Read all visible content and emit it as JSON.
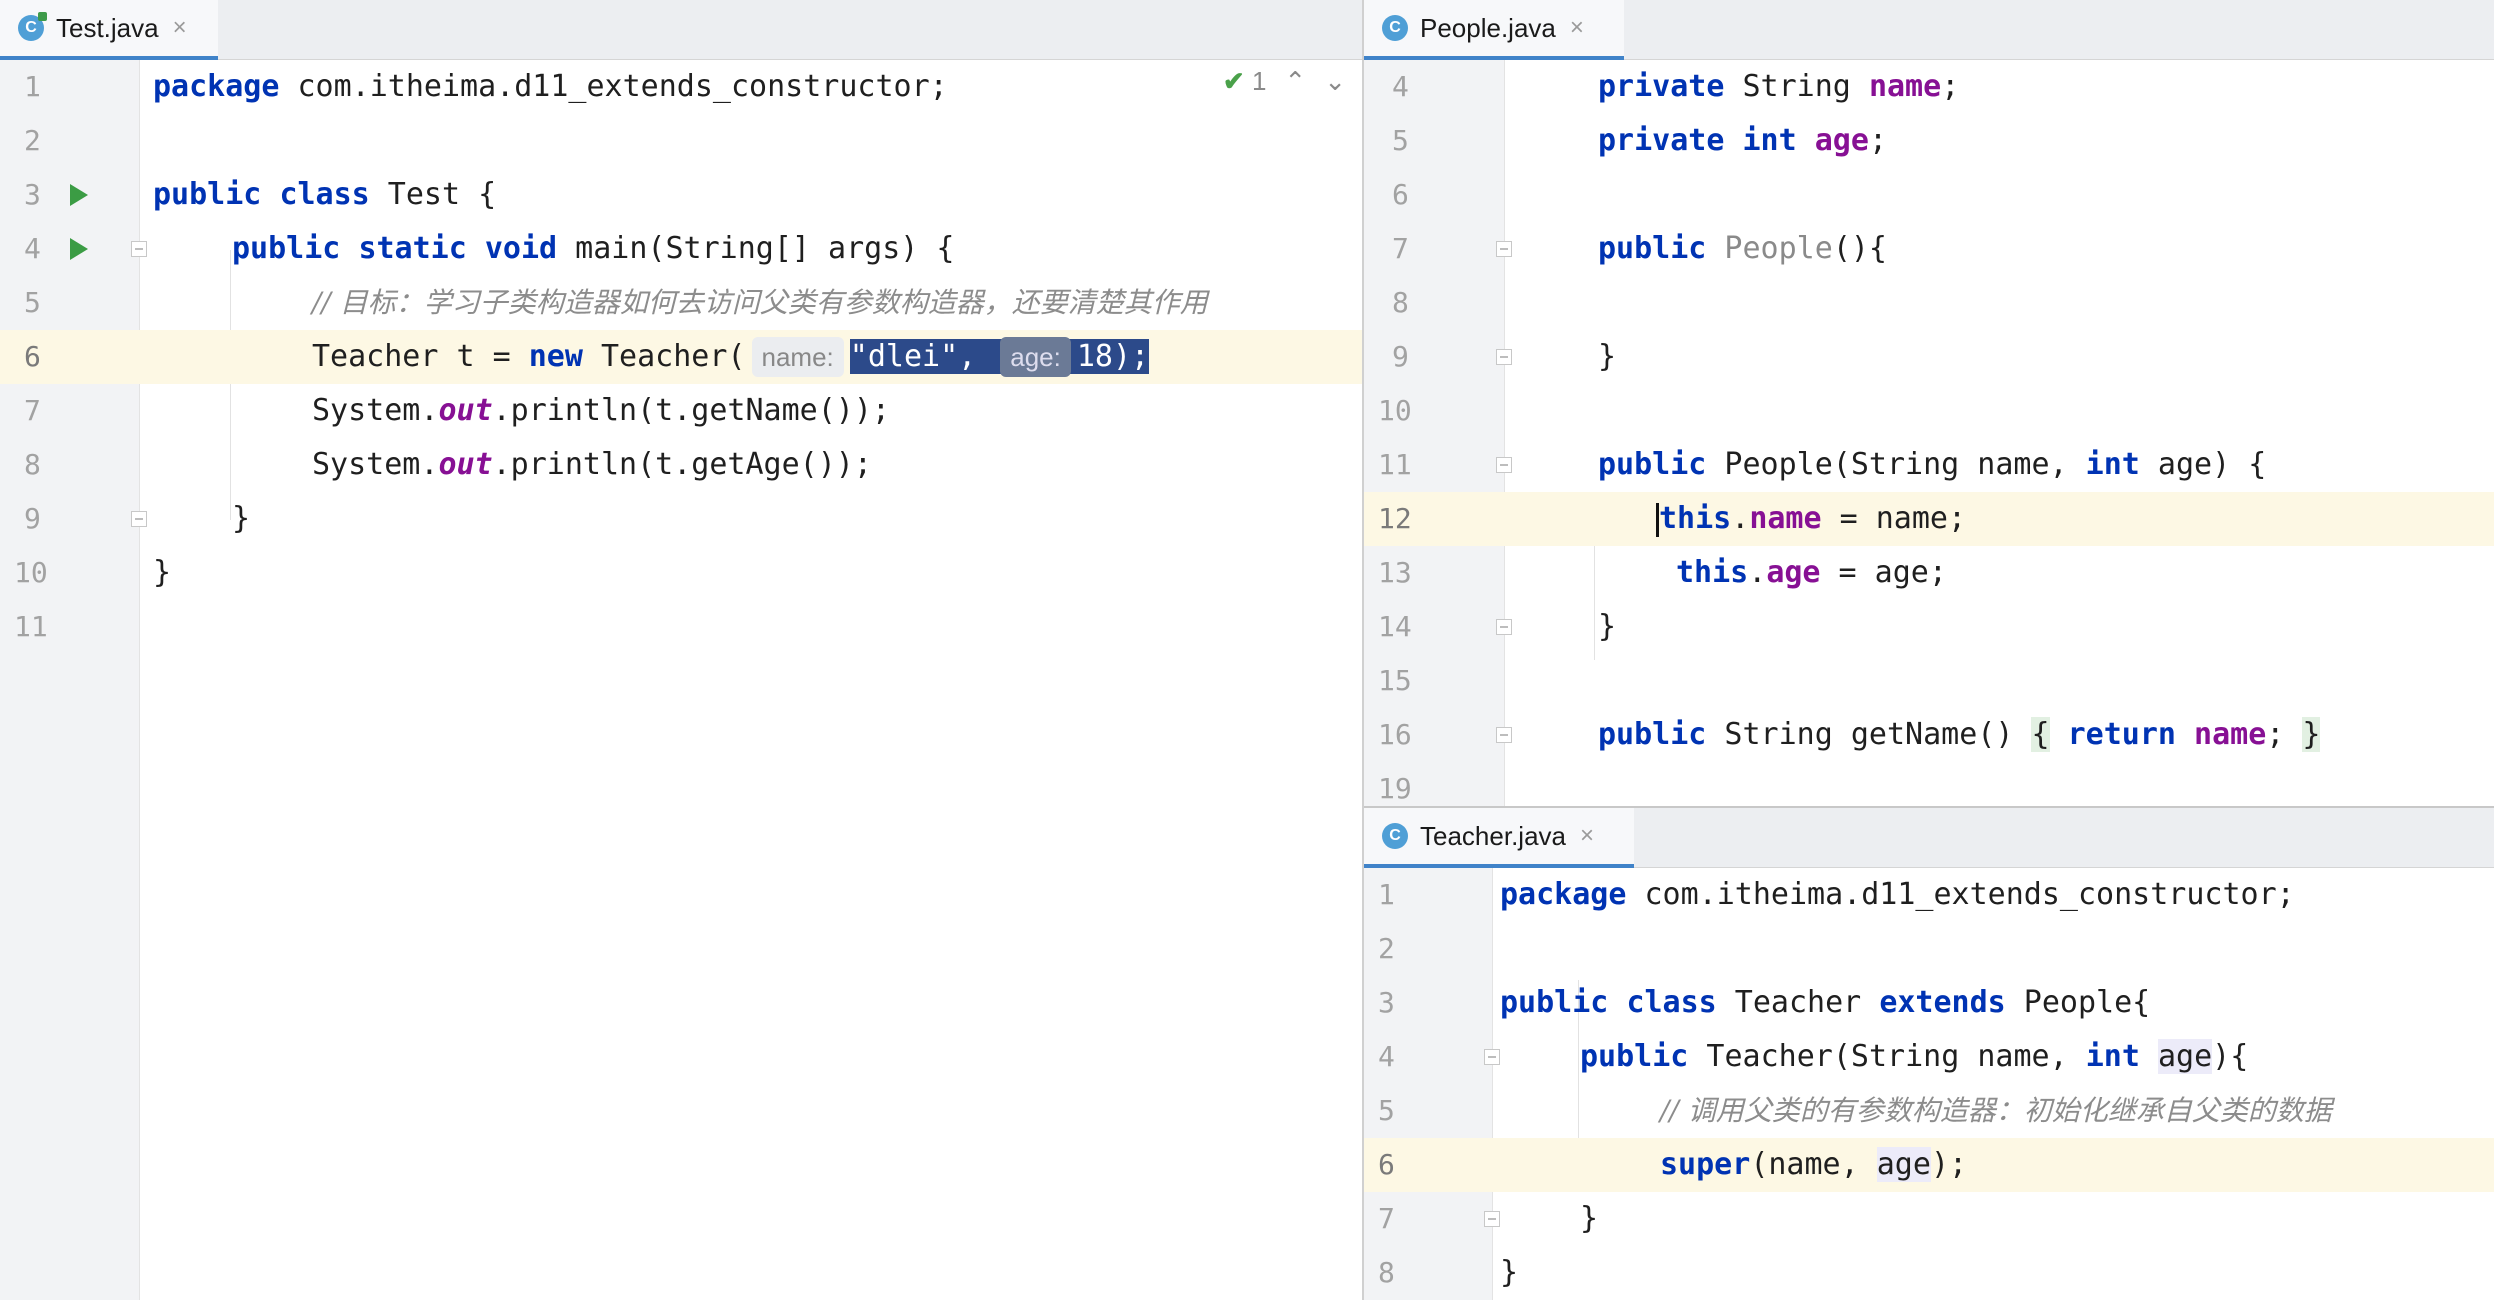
{
  "editors": {
    "left": {
      "tab": {
        "icon": "java-class-icon",
        "letter": "C",
        "label": "Test.java",
        "close": "×"
      },
      "inspections": {
        "count": "1",
        "up": "⌃",
        "down": "⌄"
      },
      "lines": [
        {
          "num": "1",
          "text": "package com.itheima.d11_extends_constructor;"
        },
        {
          "num": "2",
          "text": ""
        },
        {
          "num": "3",
          "text": "public class Test {"
        },
        {
          "num": "4",
          "text": "    public static void main(String[] args) {"
        },
        {
          "num": "5",
          "text": "        // 目标：学习子类构造器如何去访问父类有参数构造器，还要清楚其作用"
        },
        {
          "num": "6",
          "text": "        Teacher t = new Teacher( name: \"dlei\",  age: 18);"
        },
        {
          "num": "7",
          "text": "        System.out.println(t.getName());"
        },
        {
          "num": "8",
          "text": "        System.out.println(t.getAge());"
        },
        {
          "num": "9",
          "text": "    }"
        },
        {
          "num": "10",
          "text": "}"
        },
        {
          "num": "11",
          "text": ""
        }
      ],
      "tokens": {
        "package": "package",
        "pkg": " com.itheima.d11_extends_constructor;",
        "public": "public",
        "class": "class",
        "test": " Test {",
        "static": "static",
        "void": "void",
        "main": " main(String[] args) {",
        "comment": "// 目标：学习子类构造器如何去访问父类有参数构造器，还要清楚其作用",
        "teacher_decl": "Teacher t = ",
        "new": "new",
        "teacher_call": " Teacher(",
        "hint_name": "name:",
        "dlei": "\"dlei\",",
        "hint_age": "age:",
        "eighteen": "18);",
        "system": "System.",
        "out": "out",
        "println_name": ".println(t.getName());",
        "println_age": ".println(t.getAge());",
        "close_inner": "}",
        "close_outer": "}"
      }
    },
    "right_top": {
      "tab": {
        "icon": "java-class-icon",
        "letter": "C",
        "label": "People.java",
        "close": "×"
      },
      "lines": [
        {
          "num": "4"
        },
        {
          "num": "5"
        },
        {
          "num": "6"
        },
        {
          "num": "7"
        },
        {
          "num": "8"
        },
        {
          "num": "9"
        },
        {
          "num": "10"
        },
        {
          "num": "11"
        },
        {
          "num": "12"
        },
        {
          "num": "13"
        },
        {
          "num": "14"
        },
        {
          "num": "15"
        },
        {
          "num": "16"
        },
        {
          "num": "19"
        }
      ],
      "tokens": {
        "private": "private",
        "string": " String ",
        "name": "name",
        "semi": ";",
        "int": "int",
        "age": "age",
        "public": "public",
        "people_ctor": " People",
        "parens_open": "(){",
        "close": "}",
        "ctor2": " People(String name, ",
        "ctor2_tail": " age) {",
        "this": "this",
        "dot": ".",
        "assign_name": " = name;",
        "assign_age": " = age;",
        "string_getname": " String getName() ",
        "brace_open": "{",
        "return": "return",
        "brace_close": "}"
      }
    },
    "right_bottom": {
      "tab": {
        "icon": "java-class-icon",
        "letter": "C",
        "label": "Teacher.java",
        "close": "×"
      },
      "lines": [
        {
          "num": "1"
        },
        {
          "num": "2"
        },
        {
          "num": "3"
        },
        {
          "num": "4"
        },
        {
          "num": "5"
        },
        {
          "num": "6"
        },
        {
          "num": "7"
        },
        {
          "num": "8"
        }
      ],
      "tokens": {
        "package": "package",
        "pkg": " com.itheima.d11_extends_constructor;",
        "public": "public",
        "class": "class",
        "teacher": " Teacher ",
        "extends": "extends",
        "people": " People{",
        "ctor": " Teacher(String name, ",
        "int": "int",
        "age": "age",
        "ctor_tail": "){",
        "comment": "// 调用父类的有参数构造器：初始化继承自父类的数据",
        "super": "super",
        "super_args1": "(name, ",
        "super_args2": ");",
        "close_inner": "}",
        "close_outer": "}"
      }
    }
  }
}
